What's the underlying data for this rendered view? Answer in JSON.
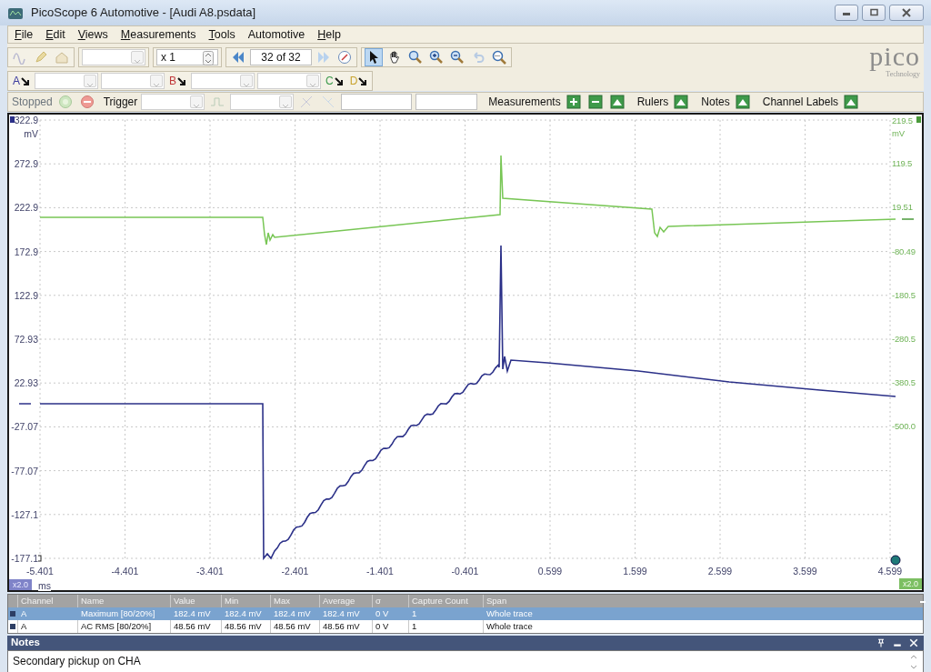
{
  "window": {
    "title": "PicoScope 6 Automotive - [Audi A8.psdata]"
  },
  "menu": [
    {
      "label": "File",
      "underline_first": true
    },
    {
      "label": "Edit",
      "underline_first": true
    },
    {
      "label": "Views",
      "underline_first": true
    },
    {
      "label": "Measurements",
      "underline_first": true
    },
    {
      "label": "Tools",
      "underline_first": true
    },
    {
      "label": "Automotive",
      "underline_first": false
    },
    {
      "label": "Help",
      "underline_first": true
    }
  ],
  "toolbar": {
    "zoom": "x 1",
    "buffer": "32 of 32",
    "tools": [
      {
        "kind": "pointer",
        "selected": true
      },
      {
        "kind": "hand",
        "selected": false
      },
      {
        "kind": "zoom",
        "selected": false
      },
      {
        "kind": "zoom-in",
        "selected": false
      },
      {
        "kind": "zoom-out",
        "selected": false
      },
      {
        "kind": "undo",
        "selected": false
      },
      {
        "kind": "zoom-fit",
        "selected": false
      }
    ]
  },
  "logo": {
    "wordmark": "pico",
    "tagline": "Technology"
  },
  "channels": [
    {
      "label": "A",
      "color": "#3a3a9e"
    },
    {
      "label": "B",
      "color": "#c0393b"
    },
    {
      "label": "C",
      "color": "#3c9a4c"
    },
    {
      "label": "D",
      "color": "#c9a431"
    }
  ],
  "capture_bar": {
    "status": "Stopped",
    "trigger": "Trigger",
    "panels": [
      "Measurements",
      "Rulers",
      "Notes",
      "Channel Labels"
    ]
  },
  "scope": {
    "y_left": {
      "unit": "mV",
      "ticks": [
        "322.9",
        "272.9",
        "222.9",
        "172.9",
        "122.9",
        "72.93",
        "22.93",
        "-27.07",
        "-77.07",
        "-127.1",
        "-177.1"
      ]
    },
    "y_right": {
      "unit": "mV",
      "ticks": [
        "219.5",
        "119.5",
        "19.51",
        "-80.49",
        "-180.5",
        "-280.5",
        "-380.5",
        "-500.0"
      ]
    },
    "x_axis": {
      "unit": "ms",
      "zoom": "x2.0",
      "ticks": [
        "-5.401",
        "-4.401",
        "-3.401",
        "-2.401",
        "-1.401",
        "-0.401",
        "0.599",
        "1.599",
        "2.599",
        "3.599",
        "4.599"
      ]
    },
    "y_zoom": "x2.0"
  },
  "measurements": {
    "columns": [
      "Channel",
      "Name",
      "Value",
      "Min",
      "Max",
      "Average",
      "σ",
      "Capture Count",
      "Span"
    ],
    "rows": [
      {
        "selected": true,
        "cells": [
          "A",
          "Maximum  [80/20%]",
          "182.4 mV",
          "182.4 mV",
          "182.4 mV",
          "182.4 mV",
          "0 V",
          "1",
          "Whole trace"
        ]
      },
      {
        "selected": false,
        "cells": [
          "A",
          "AC RMS  [80/20%]",
          "48.56 mV",
          "48.56 mV",
          "48.56 mV",
          "48.56 mV",
          "0 V",
          "1",
          "Whole trace"
        ]
      }
    ]
  },
  "notes": {
    "title": "Notes",
    "text": "Secondary pickup on CHA"
  }
}
